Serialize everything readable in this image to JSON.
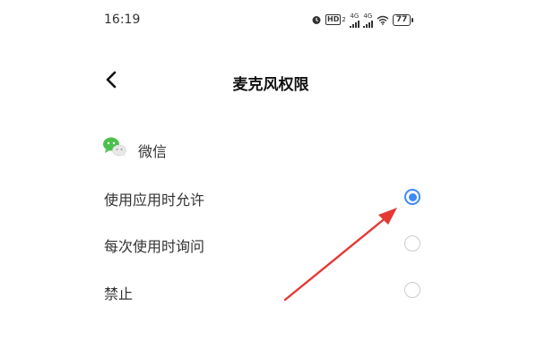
{
  "status_bar": {
    "time": "16:19",
    "hd_label": "HD",
    "hd_sub": "2",
    "net1": "4G",
    "net2": "4G",
    "battery": "77",
    "icons": [
      "alarm-icon",
      "signal-icon",
      "wifi-icon",
      "battery-icon"
    ]
  },
  "header": {
    "back_icon": "chevron-left-icon",
    "title": "麦克风权限"
  },
  "app": {
    "icon": "wechat-icon",
    "name": "微信"
  },
  "options": [
    {
      "label": "使用应用时允许",
      "selected": true
    },
    {
      "label": "每次使用时询问",
      "selected": false
    },
    {
      "label": "禁止",
      "selected": false
    }
  ],
  "colors": {
    "accent": "#3d8af7",
    "annotation_arrow": "#e53935",
    "wechat_green": "#4cc14e"
  }
}
